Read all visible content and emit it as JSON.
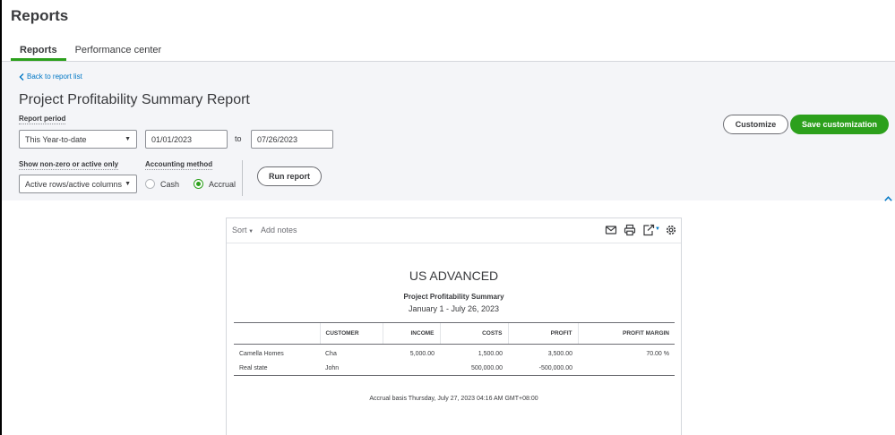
{
  "header": {
    "title": "Reports",
    "tabs": [
      {
        "label": "Reports",
        "active": true
      },
      {
        "label": "Performance center",
        "active": false
      }
    ]
  },
  "filters": {
    "back_link": "Back to report list",
    "report_title": "Project Profitability Summary Report",
    "report_period_label": "Report period",
    "report_period_value": "This Year-to-date",
    "date_from": "01/01/2023",
    "to_label": "to",
    "date_to": "07/26/2023",
    "show_label": "Show non-zero or active only",
    "show_value": "Active rows/active columns",
    "accounting_label": "Accounting method",
    "accounting_options": [
      {
        "label": "Cash",
        "checked": false
      },
      {
        "label": "Accrual",
        "checked": true
      }
    ],
    "run_report": "Run report",
    "customize": "Customize",
    "save_customization": "Save customization"
  },
  "report": {
    "toolbar": {
      "sort": "Sort",
      "add_notes": "Add notes",
      "icons": [
        "email-icon",
        "print-icon",
        "export-icon",
        "settings-icon"
      ]
    },
    "company": "US ADVANCED",
    "name": "Project Profitability Summary",
    "dates": "January 1 - July 26, 2023",
    "columns": [
      "",
      "CUSTOMER",
      "INCOME",
      "COSTS",
      "PROFIT",
      "PROFIT MARGIN"
    ],
    "rows": [
      {
        "name": "Camella Homes",
        "customer": "Cha",
        "income": "5,000.00",
        "costs": "1,500.00",
        "profit": "3,500.00",
        "margin": "70.00 %"
      },
      {
        "name": "Real state",
        "customer": "John",
        "income": "",
        "costs": "500,000.00",
        "profit": "-500,000.00",
        "margin": ""
      }
    ],
    "footer": "Accrual basis  Thursday, July 27, 2023  04:16 AM GMT+08:00"
  },
  "colors": {
    "accent_green": "#2ca01c",
    "link_blue": "#0077c5",
    "panel_bg": "#f4f5f8"
  }
}
